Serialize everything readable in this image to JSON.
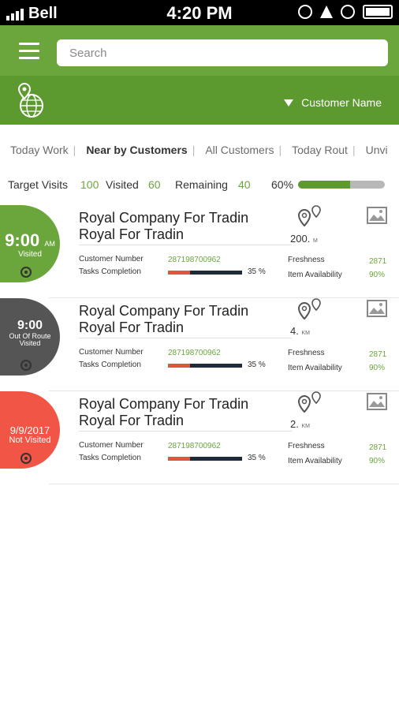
{
  "status_bar": {
    "carrier": "Bell",
    "time": "4:20 PM"
  },
  "search": {
    "placeholder": "Search"
  },
  "sub_header": {
    "customer_name": "Customer Name"
  },
  "tabs": [
    {
      "label": "Today Work"
    },
    {
      "label": "Near by Customers",
      "active": true
    },
    {
      "label": "All Customers"
    },
    {
      "label": "Today Rout"
    },
    {
      "label": "Unvi"
    }
  ],
  "stats": {
    "target_label": "Target Visits",
    "target_value": "100",
    "visited_label": "Visited",
    "visited_value": "60",
    "remaining_label": "Remaining",
    "remaining_value": "40",
    "progress_text": "60%",
    "progress": 0.6
  },
  "colors": {
    "brand_green": "#6aa63c",
    "dark_green": "#5c9a30",
    "visited": "#6aa63c",
    "out_of_route": "#555555",
    "not_visited": "#f05545"
  },
  "labels": {
    "customer_number": "Customer Number",
    "tasks_completion": "Tasks Completion",
    "freshness": "Freshness",
    "item_availability": "Item Availability"
  },
  "cards": [
    {
      "badge_time": "9:00",
      "badge_ampm": "AM",
      "badge_status": "Visited",
      "name_line1": "Royal Company For Tradin",
      "name_line2": "Royal For Tradin",
      "distance": "200.",
      "distance_unit": "M",
      "customer_number": "287198700962",
      "tasks_pct": "35 %",
      "tasks_fraction": 0.3,
      "freshness": "2871",
      "item_availability": "90%"
    },
    {
      "badge_time": "9:00",
      "badge_ampm": "",
      "badge_status": "Out Of Route Visited",
      "name_line1": "Royal Company For Tradin",
      "name_line2": "Royal For Tradin",
      "distance": "4.",
      "distance_unit": "KM",
      "customer_number": "287198700962",
      "tasks_pct": "35 %",
      "tasks_fraction": 0.3,
      "freshness": "2871",
      "item_availability": "90%"
    },
    {
      "badge_time": "9/9/2017",
      "badge_ampm": "",
      "badge_status": "Not Visited",
      "name_line1": "Royal Company For Tradin",
      "name_line2": "Royal For Tradin",
      "distance": "2.",
      "distance_unit": "KM",
      "customer_number": "287198700962",
      "tasks_pct": "35 %",
      "tasks_fraction": 0.3,
      "freshness": "2871",
      "item_availability": "90%"
    }
  ]
}
